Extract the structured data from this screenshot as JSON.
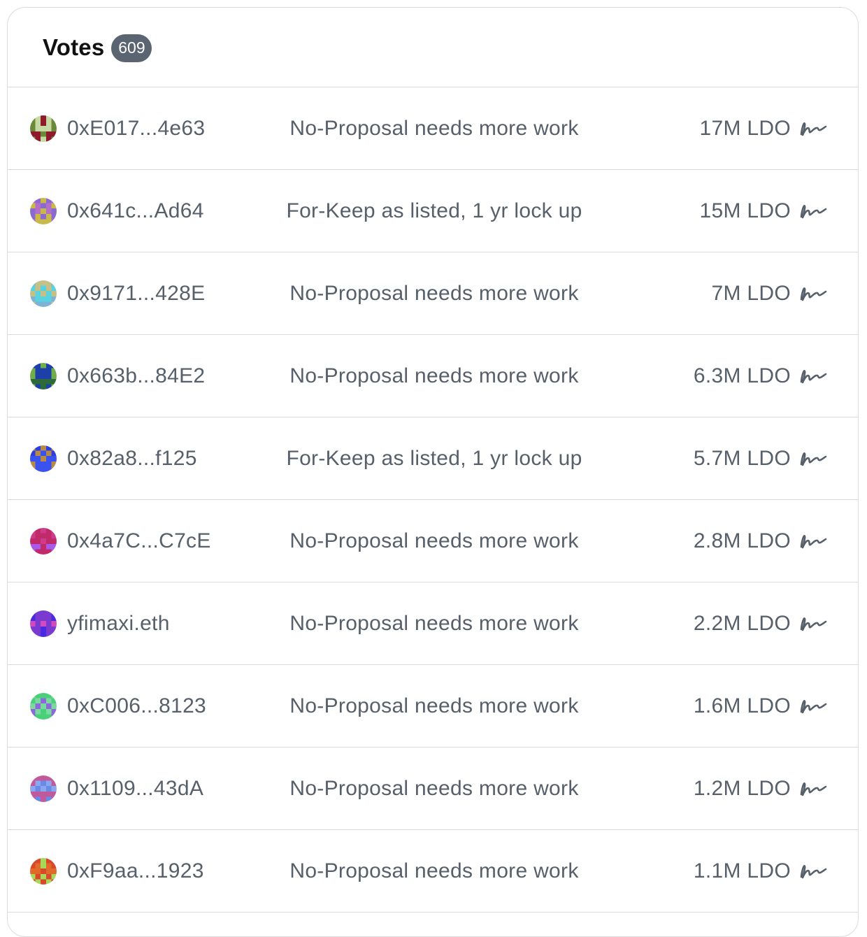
{
  "header": {
    "title": "Votes",
    "count": "609"
  },
  "votes": [
    {
      "voter": "0xE017...4e63",
      "choice": "No-Proposal needs more work",
      "power": "17M LDO",
      "avatar_colors": [
        "#8f1a2c",
        "#c6d9a3",
        "#6a8a3a"
      ]
    },
    {
      "voter": "0x641c...Ad64",
      "choice": "For-Keep as listed, 1 yr lock up",
      "power": "15M LDO",
      "avatar_colors": [
        "#b470c9",
        "#c9b84a",
        "#8a6ad0"
      ]
    },
    {
      "voter": "0x9171...428E",
      "choice": "No-Proposal needs more work",
      "power": "7M LDO",
      "avatar_colors": [
        "#5ad3e0",
        "#c6c088",
        "#7fb3d6"
      ]
    },
    {
      "voter": "0x663b...84E2",
      "choice": "No-Proposal needs more work",
      "power": "6.3M LDO",
      "avatar_colors": [
        "#1d3fa8",
        "#6fae4a",
        "#2d6a3a"
      ]
    },
    {
      "voter": "0x82a8...f125",
      "choice": "For-Keep as listed, 1 yr lock up",
      "power": "5.7M LDO",
      "avatar_colors": [
        "#2c3ee0",
        "#b68a4a",
        "#3a52f0"
      ]
    },
    {
      "voter": "0x4a7C...C7cE",
      "choice": "No-Proposal needs more work",
      "power": "2.8M LDO",
      "avatar_colors": [
        "#c02a6a",
        "#a95ae8",
        "#d03a8a"
      ]
    },
    {
      "voter": "yfimaxi.eth",
      "choice": "No-Proposal needs more work",
      "power": "2.2M LDO",
      "avatar_colors": [
        "#4a2ae0",
        "#d04ac0",
        "#7a3ad0"
      ]
    },
    {
      "voter": "0xC006...8123",
      "choice": "No-Proposal needs more work",
      "power": "1.6M LDO",
      "avatar_colors": [
        "#4ad07a",
        "#8a6ad8",
        "#7ad8a0"
      ]
    },
    {
      "voter": "0x1109...43dA",
      "choice": "No-Proposal needs more work",
      "power": "1.2M LDO",
      "avatar_colors": [
        "#6a8ae8",
        "#c05a9a",
        "#8aa8f0"
      ]
    },
    {
      "voter": "0xF9aa...1923",
      "choice": "No-Proposal needs more work",
      "power": "1.1M LDO",
      "avatar_colors": [
        "#e06a2a",
        "#a8d85a",
        "#d8482a"
      ]
    }
  ],
  "icons": {
    "signature": "signature-icon"
  },
  "colors": {
    "badge_bg": "#5b6471",
    "text": "#57606a",
    "title": "#111111",
    "border": "#dcdcdc"
  }
}
